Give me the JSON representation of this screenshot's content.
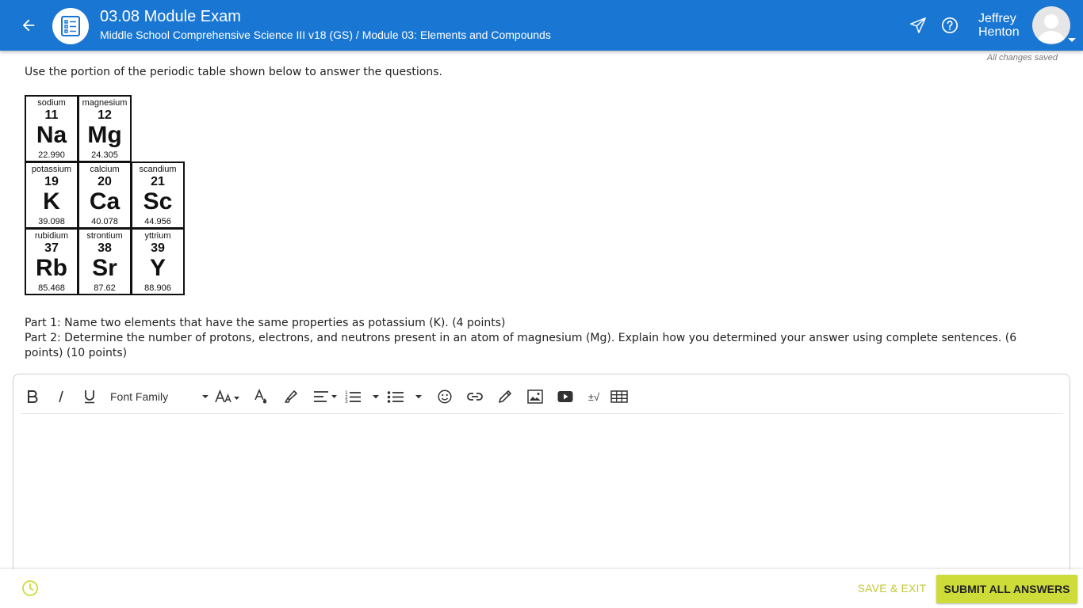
{
  "header": {
    "title": "03.08 Module Exam",
    "subtitle": "Middle School Comprehensive Science III v18 (GS) / Module 03: Elements and Compounds",
    "user_first": "Jeffrey",
    "user_last": "Henton",
    "bg_color": "#1976d2",
    "icons": [
      "arrow-back-icon",
      "checklist-icon",
      "send-icon",
      "help-icon",
      "avatar-icon"
    ]
  },
  "status": {
    "saved": "All changes saved"
  },
  "question": {
    "instructions": "Use the portion of the periodic table shown below to answer the questions.",
    "part1": "Part 1: Name two elements that have the same properties as potassium (K). (4 points)",
    "part2": "Part 2: Determine the number of protons, electrons, and neutrons present in an atom of magnesium (Mg). Explain how you determined your answer using complete sentences. (6 points) (10 points)"
  },
  "periodic_table": {
    "elements": [
      {
        "name": "sodium",
        "number": "11",
        "symbol": "Na",
        "mass": "22.990",
        "row": 0,
        "col": 0
      },
      {
        "name": "magnesium",
        "number": "12",
        "symbol": "Mg",
        "mass": "24.305",
        "row": 0,
        "col": 1
      },
      {
        "name": "potassium",
        "number": "19",
        "symbol": "K",
        "mass": "39.098",
        "row": 1,
        "col": 0
      },
      {
        "name": "calcium",
        "number": "20",
        "symbol": "Ca",
        "mass": "40.078",
        "row": 1,
        "col": 1
      },
      {
        "name": "scandium",
        "number": "21",
        "symbol": "Sc",
        "mass": "44.956",
        "row": 1,
        "col": 2
      },
      {
        "name": "rubidium",
        "number": "37",
        "symbol": "Rb",
        "mass": "85.468",
        "row": 2,
        "col": 0
      },
      {
        "name": "strontium",
        "number": "38",
        "symbol": "Sr",
        "mass": "87.62",
        "row": 2,
        "col": 1
      },
      {
        "name": "yttrium",
        "number": "39",
        "symbol": "Y",
        "mass": "88.906",
        "row": 2,
        "col": 2
      }
    ]
  },
  "editor": {
    "font_family_label": "Font Family",
    "plusminus_label": "±√",
    "toolbar_icons": [
      "bold-icon",
      "italic-icon",
      "underline-icon",
      "font-size-icon",
      "text-color-icon",
      "highlight-icon",
      "align-icon",
      "ordered-list-icon",
      "bullet-list-icon",
      "emoji-icon",
      "link-icon",
      "draw-icon",
      "image-icon",
      "video-icon",
      "math-icon",
      "table-icon"
    ]
  },
  "footer": {
    "save_exit": "SAVE & EXIT",
    "submit": "SUBMIT ALL ANSWERS",
    "accent_color": "#cddc39"
  }
}
